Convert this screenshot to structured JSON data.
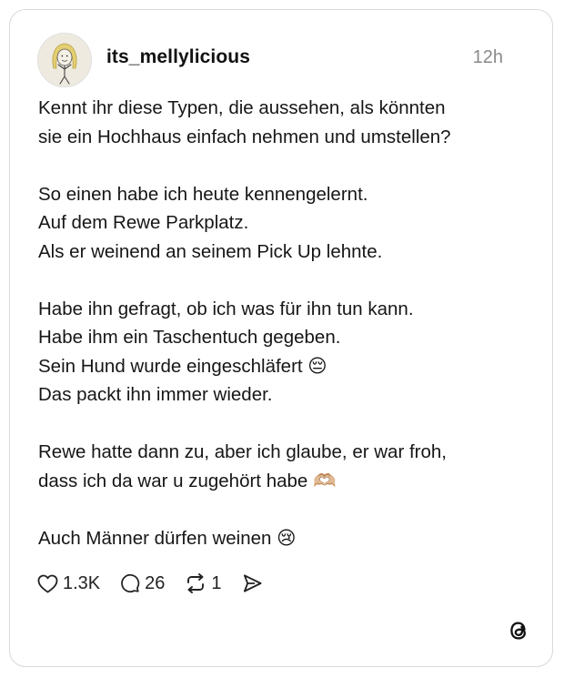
{
  "post": {
    "username": "its_mellylicious",
    "time": "12h",
    "lines": [
      "Kennt ihr diese Typen, die aussehen, als könnten",
      "sie ein Hochhaus einfach nehmen und umstellen?",
      "",
      "So einen habe ich heute kennengelernt.",
      "Auf dem Rewe Parkplatz.",
      "Als er weinend an seinem Pick Up lehnte.",
      "",
      "Habe ihn gefragt, ob ich was für ihn tun kann.",
      "Habe ihm ein Taschentuch gegeben.",
      "Sein Hund wurde eingeschläfert 😔",
      "Das packt ihn immer wieder.",
      "",
      "Rewe hatte dann zu, aber ich glaube, er war froh,",
      "dass ich da war u zugehört habe 🫶🏼",
      "",
      "Auch Männer dürfen weinen 😢"
    ],
    "actions": {
      "likes": "1.3K",
      "replies": "26",
      "reposts": "1"
    }
  },
  "icons": {
    "like": "heart-icon",
    "reply": "speech-bubble-icon",
    "repost": "repost-icon",
    "share": "send-icon",
    "brand": "threads-logo-icon"
  },
  "colors": {
    "text": "#161616",
    "muted": "#8a8a8a",
    "border": "#d9d9d9"
  }
}
